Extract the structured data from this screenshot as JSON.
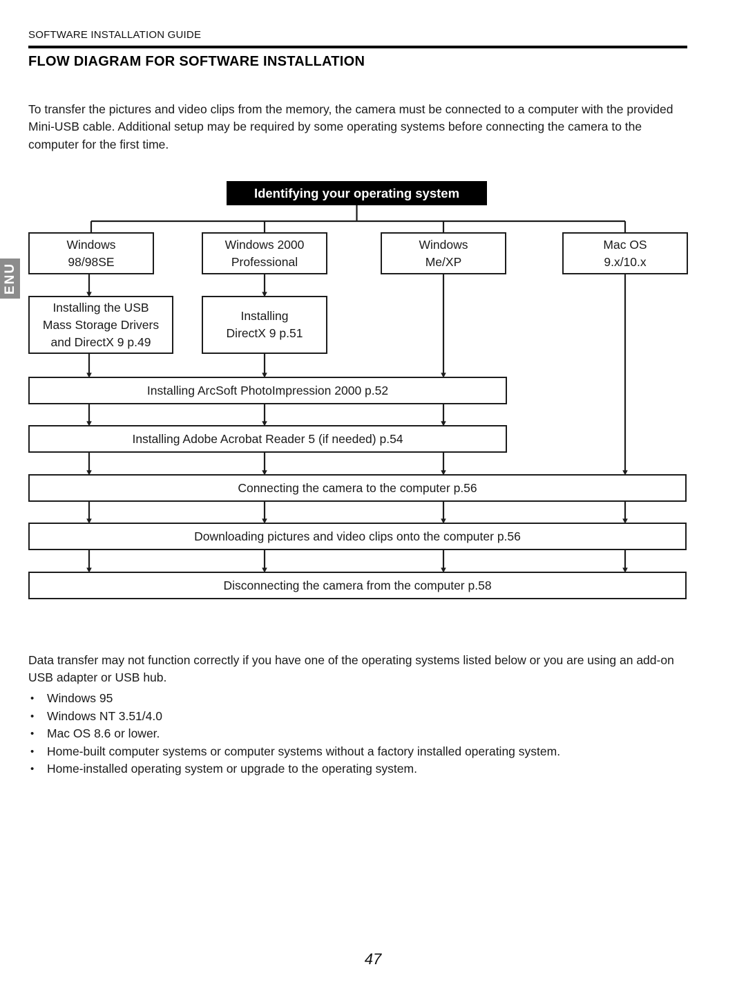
{
  "header": {
    "running_head": "SOFTWARE INSTALLATION GUIDE",
    "title": "FLOW DIAGRAM FOR SOFTWARE INSTALLATION"
  },
  "side_tab": {
    "label": "ENU"
  },
  "intro_paragraph": "To transfer the pictures and video clips from the memory, the camera must be connected to a computer with the provided Mini-USB cable.  Additional setup may be required by some operating systems before connecting the camera to the computer for the first time.",
  "flow": {
    "root": {
      "label": "Identifying your operating system"
    },
    "os_options": [
      {
        "line1": "Windows",
        "line2": "98/98SE"
      },
      {
        "line1": "Windows 2000",
        "line2": "Professional"
      },
      {
        "line1": "Windows",
        "line2": "Me/XP"
      },
      {
        "line1": "Mac OS",
        "line2": "9.x/10.x"
      }
    ],
    "driver_steps": [
      {
        "line1": "Installing the USB",
        "line2": "Mass Storage Drivers",
        "line3": "and DirectX 9 p.49"
      },
      {
        "line1": "Installing",
        "line2": "DirectX 9 p.51"
      }
    ],
    "shared_steps": [
      {
        "label": "Installing ArcSoft PhotoImpression 2000 p.52"
      },
      {
        "label": "Installing Adobe Acrobat Reader 5 (if needed) p.54"
      },
      {
        "label": "Connecting the camera to the computer p.56"
      },
      {
        "label": "Downloading pictures and video clips onto the computer p.56"
      },
      {
        "label": "Disconnecting the camera from the computer p.58"
      }
    ]
  },
  "note_paragraph": "Data transfer may not function correctly if you have one of the operating systems listed below or you are using an add-on USB adapter or USB hub.",
  "unsupported_systems": [
    "Windows 95",
    "Windows NT 3.51/4.0",
    "Mac OS 8.6 or lower.",
    "Home-built computer systems or computer systems without a factory installed operating system.",
    "Home-installed operating system or upgrade to the operating system."
  ],
  "bullet_glyph": "•",
  "page_number": "47",
  "colors": {
    "text": "#1a1a1a",
    "line": "#1c1c1c",
    "header_box_bg": "#000000",
    "header_box_fg": "#ffffff",
    "side_tab_bg": "#8c8c8c"
  }
}
